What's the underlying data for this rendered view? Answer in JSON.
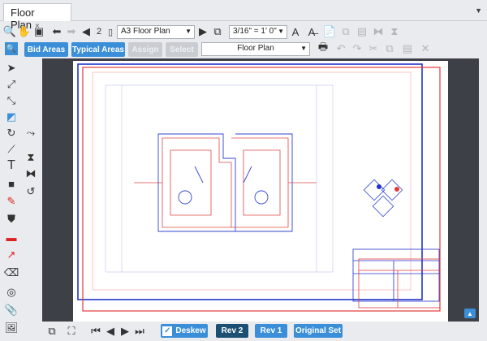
{
  "tab": {
    "title": "Floor Plan",
    "close": "×"
  },
  "toolbar": {
    "page_number": "2",
    "sheet_select": "A3 Floor Plan",
    "scale_select": "3/16\" = 1' 0\""
  },
  "toolbar2": {
    "bid_areas": "Bid Areas",
    "typical_areas": "Typical Areas",
    "assign": "Assign",
    "select": "Select",
    "layer_select": "Floor Plan"
  },
  "bottom": {
    "deskew": "Deskew",
    "rev2": "Rev 2",
    "rev1": "Rev 1",
    "original_set": "Original Set"
  },
  "colors": {
    "accent": "#3a8fd8",
    "active": "#1c4f74",
    "canvas": "#3e4047"
  }
}
